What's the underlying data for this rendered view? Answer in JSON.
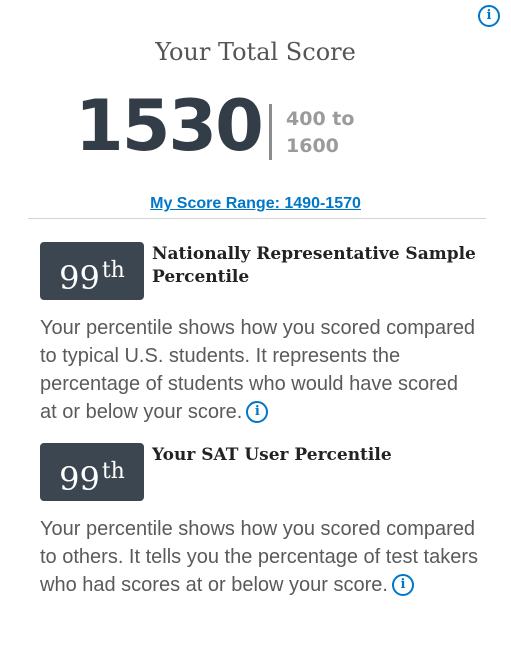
{
  "header": {
    "title": "Your Total Score",
    "total_score": "1530",
    "range_line1": "400 to",
    "range_line2": "1600",
    "score_range_link": "My Score Range: 1490-1570"
  },
  "percentiles": [
    {
      "number": "99",
      "suffix": "th",
      "title": "Nationally Representative Sample Percentile",
      "description": "Your percentile shows how you scored compared to typical U.S. students. It represents the percentage of students who would have scored at or below your score."
    },
    {
      "number": "99",
      "suffix": "th",
      "title": "Your SAT User Percentile",
      "description": "Your percentile shows how you scored compared to others. It tells you the percentage of test takers who had scores at or below your score."
    }
  ],
  "icons": {
    "info": "info-icon",
    "info_glyph": "i"
  },
  "colors": {
    "accent_blue": "#0077c8",
    "score_dark": "#333d47",
    "percentile_box": "#3c4650",
    "muted_gray": "#9b9b9b"
  }
}
